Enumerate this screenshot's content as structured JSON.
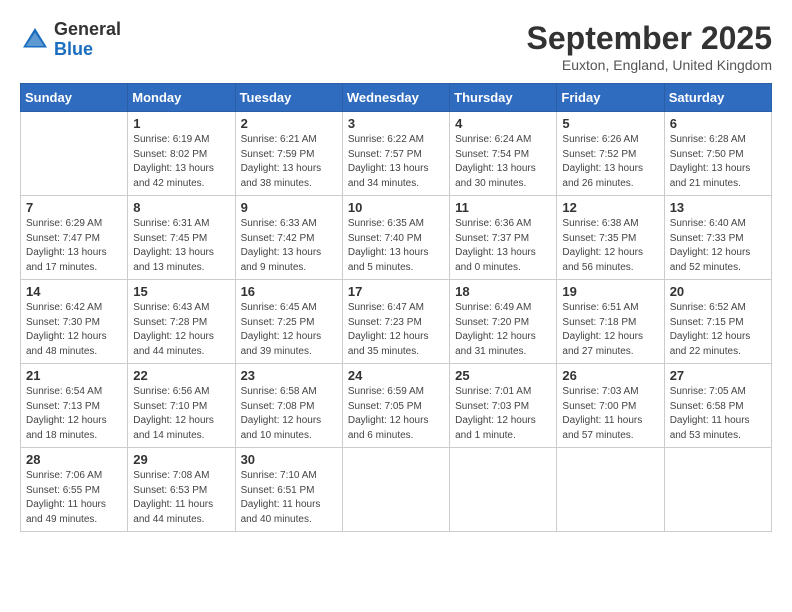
{
  "header": {
    "logo_general": "General",
    "logo_blue": "Blue",
    "month_title": "September 2025",
    "location": "Euxton, England, United Kingdom"
  },
  "days_of_week": [
    "Sunday",
    "Monday",
    "Tuesday",
    "Wednesday",
    "Thursday",
    "Friday",
    "Saturday"
  ],
  "weeks": [
    [
      {
        "day": "",
        "info": ""
      },
      {
        "day": "1",
        "info": "Sunrise: 6:19 AM\nSunset: 8:02 PM\nDaylight: 13 hours\nand 42 minutes."
      },
      {
        "day": "2",
        "info": "Sunrise: 6:21 AM\nSunset: 7:59 PM\nDaylight: 13 hours\nand 38 minutes."
      },
      {
        "day": "3",
        "info": "Sunrise: 6:22 AM\nSunset: 7:57 PM\nDaylight: 13 hours\nand 34 minutes."
      },
      {
        "day": "4",
        "info": "Sunrise: 6:24 AM\nSunset: 7:54 PM\nDaylight: 13 hours\nand 30 minutes."
      },
      {
        "day": "5",
        "info": "Sunrise: 6:26 AM\nSunset: 7:52 PM\nDaylight: 13 hours\nand 26 minutes."
      },
      {
        "day": "6",
        "info": "Sunrise: 6:28 AM\nSunset: 7:50 PM\nDaylight: 13 hours\nand 21 minutes."
      }
    ],
    [
      {
        "day": "7",
        "info": "Sunrise: 6:29 AM\nSunset: 7:47 PM\nDaylight: 13 hours\nand 17 minutes."
      },
      {
        "day": "8",
        "info": "Sunrise: 6:31 AM\nSunset: 7:45 PM\nDaylight: 13 hours\nand 13 minutes."
      },
      {
        "day": "9",
        "info": "Sunrise: 6:33 AM\nSunset: 7:42 PM\nDaylight: 13 hours\nand 9 minutes."
      },
      {
        "day": "10",
        "info": "Sunrise: 6:35 AM\nSunset: 7:40 PM\nDaylight: 13 hours\nand 5 minutes."
      },
      {
        "day": "11",
        "info": "Sunrise: 6:36 AM\nSunset: 7:37 PM\nDaylight: 13 hours\nand 0 minutes."
      },
      {
        "day": "12",
        "info": "Sunrise: 6:38 AM\nSunset: 7:35 PM\nDaylight: 12 hours\nand 56 minutes."
      },
      {
        "day": "13",
        "info": "Sunrise: 6:40 AM\nSunset: 7:33 PM\nDaylight: 12 hours\nand 52 minutes."
      }
    ],
    [
      {
        "day": "14",
        "info": "Sunrise: 6:42 AM\nSunset: 7:30 PM\nDaylight: 12 hours\nand 48 minutes."
      },
      {
        "day": "15",
        "info": "Sunrise: 6:43 AM\nSunset: 7:28 PM\nDaylight: 12 hours\nand 44 minutes."
      },
      {
        "day": "16",
        "info": "Sunrise: 6:45 AM\nSunset: 7:25 PM\nDaylight: 12 hours\nand 39 minutes."
      },
      {
        "day": "17",
        "info": "Sunrise: 6:47 AM\nSunset: 7:23 PM\nDaylight: 12 hours\nand 35 minutes."
      },
      {
        "day": "18",
        "info": "Sunrise: 6:49 AM\nSunset: 7:20 PM\nDaylight: 12 hours\nand 31 minutes."
      },
      {
        "day": "19",
        "info": "Sunrise: 6:51 AM\nSunset: 7:18 PM\nDaylight: 12 hours\nand 27 minutes."
      },
      {
        "day": "20",
        "info": "Sunrise: 6:52 AM\nSunset: 7:15 PM\nDaylight: 12 hours\nand 22 minutes."
      }
    ],
    [
      {
        "day": "21",
        "info": "Sunrise: 6:54 AM\nSunset: 7:13 PM\nDaylight: 12 hours\nand 18 minutes."
      },
      {
        "day": "22",
        "info": "Sunrise: 6:56 AM\nSunset: 7:10 PM\nDaylight: 12 hours\nand 14 minutes."
      },
      {
        "day": "23",
        "info": "Sunrise: 6:58 AM\nSunset: 7:08 PM\nDaylight: 12 hours\nand 10 minutes."
      },
      {
        "day": "24",
        "info": "Sunrise: 6:59 AM\nSunset: 7:05 PM\nDaylight: 12 hours\nand 6 minutes."
      },
      {
        "day": "25",
        "info": "Sunrise: 7:01 AM\nSunset: 7:03 PM\nDaylight: 12 hours\nand 1 minute."
      },
      {
        "day": "26",
        "info": "Sunrise: 7:03 AM\nSunset: 7:00 PM\nDaylight: 11 hours\nand 57 minutes."
      },
      {
        "day": "27",
        "info": "Sunrise: 7:05 AM\nSunset: 6:58 PM\nDaylight: 11 hours\nand 53 minutes."
      }
    ],
    [
      {
        "day": "28",
        "info": "Sunrise: 7:06 AM\nSunset: 6:55 PM\nDaylight: 11 hours\nand 49 minutes."
      },
      {
        "day": "29",
        "info": "Sunrise: 7:08 AM\nSunset: 6:53 PM\nDaylight: 11 hours\nand 44 minutes."
      },
      {
        "day": "30",
        "info": "Sunrise: 7:10 AM\nSunset: 6:51 PM\nDaylight: 11 hours\nand 40 minutes."
      },
      {
        "day": "",
        "info": ""
      },
      {
        "day": "",
        "info": ""
      },
      {
        "day": "",
        "info": ""
      },
      {
        "day": "",
        "info": ""
      }
    ]
  ]
}
